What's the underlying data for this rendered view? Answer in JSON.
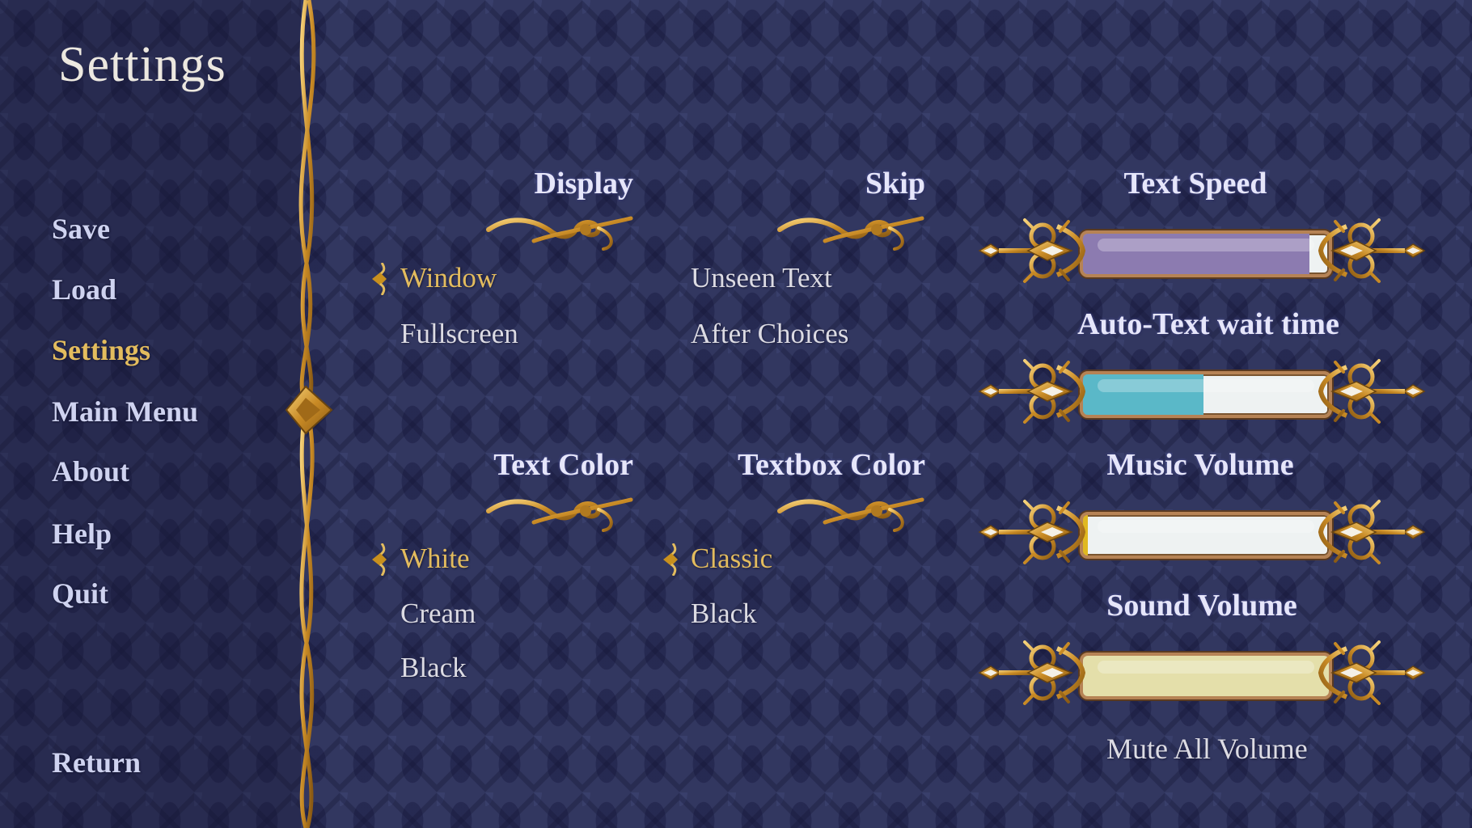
{
  "title": "Settings",
  "nav": {
    "items": [
      {
        "label": "Save",
        "active": false
      },
      {
        "label": "Load",
        "active": false
      },
      {
        "label": "Settings",
        "active": true
      },
      {
        "label": "Main Menu",
        "active": false
      },
      {
        "label": "About",
        "active": false
      },
      {
        "label": "Help",
        "active": false
      },
      {
        "label": "Quit",
        "active": false
      }
    ],
    "return_label": "Return"
  },
  "display": {
    "header": "Display",
    "options": [
      {
        "label": "Window",
        "selected": true
      },
      {
        "label": "Fullscreen",
        "selected": false
      }
    ]
  },
  "skip": {
    "header": "Skip",
    "options": [
      {
        "label": "Unseen Text",
        "selected": false
      },
      {
        "label": "After Choices",
        "selected": false
      }
    ]
  },
  "text_color": {
    "header": "Text Color",
    "options": [
      {
        "label": "White",
        "selected": true
      },
      {
        "label": "Cream",
        "selected": false
      },
      {
        "label": "Black",
        "selected": false
      }
    ]
  },
  "textbox_color": {
    "header": "Textbox Color",
    "options": [
      {
        "label": "Classic",
        "selected": true
      },
      {
        "label": "Black",
        "selected": false
      }
    ]
  },
  "sliders": [
    {
      "label": "Text Speed",
      "value": 0.92,
      "fill_color": "#8c7bb0"
    },
    {
      "label": "Auto-Text wait time",
      "value": 0.49,
      "fill_color": "#5ab8c8"
    },
    {
      "label": "Music Volume",
      "value": 0.02,
      "fill_color": "#e0b820"
    },
    {
      "label": "Sound Volume",
      "value": 1.0,
      "fill_color": "#e4dfaa"
    }
  ],
  "mute_label": "Mute All Volume",
  "colors": {
    "accent_gold": "#e3bc5e",
    "nav_text": "#cfd3f0",
    "option_text": "#dcdbe3",
    "background": "#323760"
  }
}
